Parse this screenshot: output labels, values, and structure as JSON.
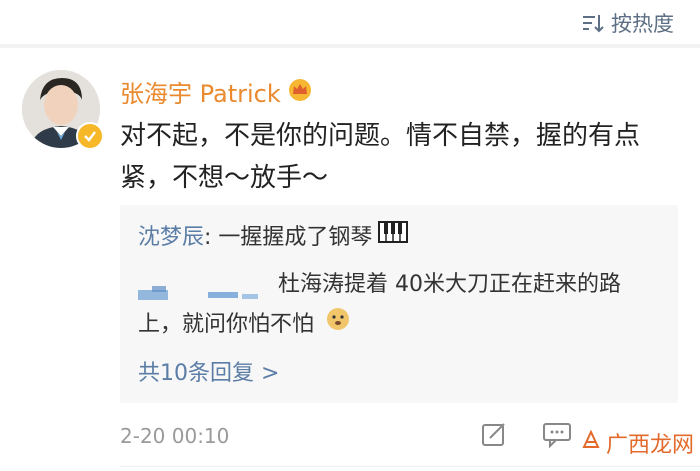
{
  "sort": {
    "label": "按热度"
  },
  "comment": {
    "author": "张海宇 Patrick",
    "text": "对不起，不是你的问题。情不自禁，握的有点紧，不想～放手～",
    "time": "2-20 00:10"
  },
  "replies": {
    "first": {
      "name": "沈梦辰",
      "text": ": 一握握成了钢琴"
    },
    "second": {
      "text": "杜海涛提着 40米大刀正在赶来的路上，就问你怕不怕"
    },
    "more_label": "共10条回复 >"
  },
  "watermark": {
    "text": "广西龙网"
  },
  "colors": {
    "author": "#ea8a2e",
    "link": "#5b7da6",
    "verified": "#f6b829"
  }
}
